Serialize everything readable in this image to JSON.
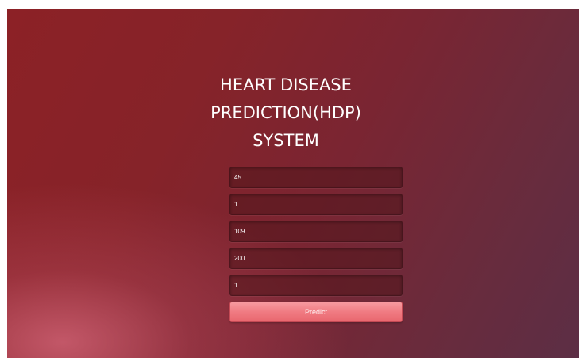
{
  "page": {
    "title_lines": [
      "HEART DISEASE",
      "PREDICTION(HDP)",
      "SYSTEM"
    ]
  },
  "form": {
    "fields": [
      {
        "value": "45"
      },
      {
        "value": "1"
      },
      {
        "value": "109"
      },
      {
        "value": "200"
      },
      {
        "value": "1"
      }
    ],
    "submit_label": "Predict"
  },
  "colors": {
    "background_start": "#8c2126",
    "background_end": "#5c2e45",
    "button": "#f07b82",
    "text": "#ffffff"
  }
}
